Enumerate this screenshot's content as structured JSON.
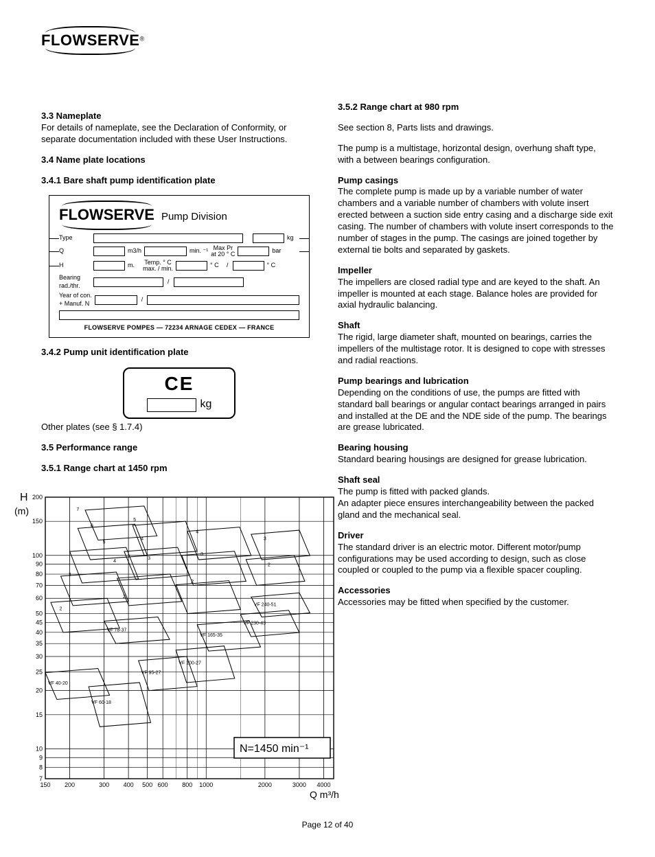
{
  "brand": "FLOWSERVE",
  "header": {
    "section_3_3": "3.3  Nameplate",
    "section_3_3_text": "For details of nameplate, see the Declaration of Conformity, or separate documentation included with these User Instructions.",
    "section_3_4": "3.4  Name plate locations",
    "section_3_4_1": "3.4.1  Bare shaft pump identification plate",
    "nameplate": {
      "division": "Pump Division",
      "row_type_lbl": "Type",
      "row_type_unit": "kg",
      "row_q_lbl": "Q",
      "row_q_unit1": "m3/h",
      "row_q_unit2": "min. ⁻¹",
      "row_q_lbl3": "Max Pr\nat 20 ° C",
      "row_q_unit3": "bar",
      "row_h_lbl": "H",
      "row_h_unit1": "m.",
      "row_h_lbl2": "Temp. ° C\nmax. / min.",
      "row_h_unit2": "° C",
      "row_h_unit3": "° C",
      "row_bearing_lbl": "Bearing\nrad./thr.",
      "row_year_lbl": "Year of con.\n+ Manuf. N",
      "footer": "FLOWSERVE  POMPES  —  72234  ARNAGE  CEDEX  —  FRANCE"
    },
    "section_3_4_2": "3.4.2  Pump unit identification plate",
    "ce_unit": "kg",
    "section_3_4_2_note": "Other plates (see § 1.7.4)",
    "section_3_5": "3.5  Performance range",
    "section_3_5_1": "3.5.1  Range chart at 1450 rpm",
    "section_3_5_2": "3.5.2  Range chart at 980 rpm"
  },
  "right_col": {
    "see_section_8": "See section 8, Parts lists and drawings.",
    "p1": "The pump is a multistage, horizontal design, overhung shaft type, with a between bearings configuration.",
    "h_casing": "Pump casings",
    "p_casing": "The complete pump is made up by a variable number of water chambers and a variable number of chambers with volute insert erected between a suction side entry casing and a discharge side exit casing. The number of chambers with volute insert corresponds to the number of stages in the pump. The casings are joined together by external tie bolts and separated by gaskets.",
    "h_imp": "Impeller",
    "p_imp": "The impellers are closed radial type and are keyed to the shaft. An impeller is mounted at each stage. Balance holes are provided for axial hydraulic balancing.",
    "h_shaft": "Shaft",
    "p_shaft": "The rigid, large diameter shaft, mounted on bearings, carries the impellers of the multistage rotor. It is designed to cope with stresses and radial reactions.",
    "h_brg": "Pump bearings and lubrication",
    "p_brg": "Depending on the conditions of use, the pumps are fitted with standard ball bearings or angular contact bearings arranged in pairs and installed at the DE and the NDE side of the pump. The bearings are grease lubricated.",
    "h_hou": "Bearing housing",
    "p_hou": "Standard bearing housings are designed for grease lubrication.",
    "h_seal": "Shaft seal",
    "p_seal_1": "The pump is fitted with packed glands.",
    "p_seal_2": "An adapter piece ensures interchangeability between the packed gland and the mechanical seal.",
    "h_drv": "Driver",
    "p_drv": "The standard driver is an electric motor. Different motor/pump configurations may be used according to design, such as close coupled or coupled to the pump via a flexible spacer coupling.",
    "h_acc": "Accessories",
    "p_acc": "Accessories may be fitted when specified by the customer."
  },
  "chart_data": [
    {
      "type": "range-chart",
      "title": "Range chart at 1450 rpm",
      "speed_label": "N=1450  min⁻¹",
      "xlabel": "Q m³/h",
      "ylabel": "H (m)",
      "x_ticks": [
        150,
        200,
        300,
        400,
        500,
        600,
        800,
        1000,
        2000,
        3000,
        4000
      ],
      "y_ticks": [
        7,
        8,
        9,
        10,
        15,
        20,
        25,
        30,
        35,
        40,
        45,
        50,
        60,
        70,
        80,
        90,
        100,
        150,
        200
      ],
      "xlim": [
        150,
        4500
      ],
      "ylim": [
        7,
        200
      ],
      "series_labels": [
        "VF 40-20",
        "VF 60-18",
        "VF 78-37",
        "VF 95-27",
        "VF 100-27",
        "VF 165-35",
        "VF 230-43",
        "VF 240-51"
      ],
      "stage_numbers": [
        1,
        2,
        3,
        4,
        5,
        6,
        7
      ]
    }
  ],
  "page_number": "Page 12 of 40"
}
